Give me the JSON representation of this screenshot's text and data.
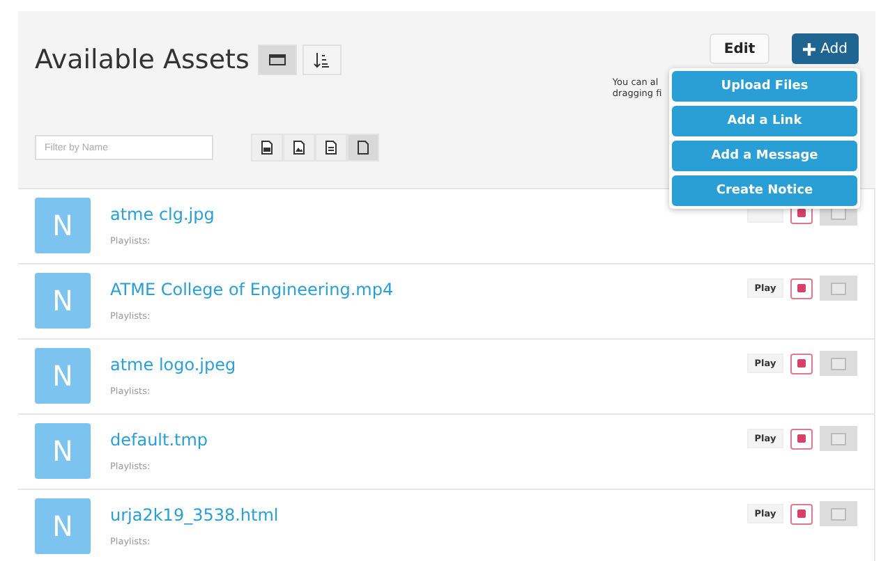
{
  "header": {
    "title": "Available Assets",
    "view_toggles": [
      {
        "kind": "grid",
        "selected": true
      },
      {
        "kind": "sort",
        "selected": false
      }
    ],
    "filter": {
      "placeholder": "Filter by Name"
    },
    "type_filters": [
      {
        "kind": "video",
        "selected": false
      },
      {
        "kind": "image",
        "selected": false
      },
      {
        "kind": "document",
        "selected": false
      },
      {
        "kind": "all",
        "selected": true
      }
    ],
    "edit_label": "Edit",
    "add_label": "Add",
    "hint_lines": [
      "You can al",
      "dragging fi"
    ]
  },
  "add_menu": [
    "Upload Files",
    "Add a Link",
    "Add a Message",
    "Create Notice"
  ],
  "assets": [
    {
      "initial": "N",
      "name": "atme clg.jpg",
      "playlists": "Playlists:",
      "checked": false
    },
    {
      "initial": "N",
      "name": "ATME College of Engineering.mp4",
      "playlists": "Playlists:",
      "play": "Play",
      "checked": false
    },
    {
      "initial": "N",
      "name": "atme logo.jpeg",
      "playlists": "Playlists:",
      "play": "Play",
      "checked": false
    },
    {
      "initial": "N",
      "name": "default.tmp",
      "playlists": "Playlists:",
      "play": "Play",
      "checked": false
    },
    {
      "initial": "N",
      "name": "urja2k19_3538.html",
      "playlists": "Playlists:",
      "play": "Play",
      "checked": false
    }
  ]
}
